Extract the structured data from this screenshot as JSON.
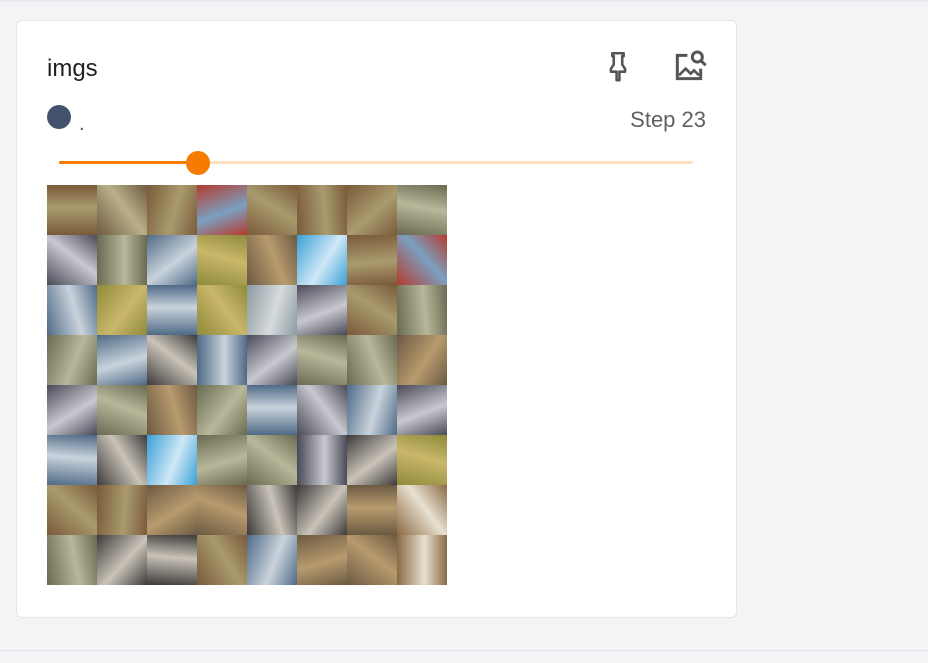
{
  "card": {
    "title": "imgs",
    "legend_label": ".",
    "step_text": "Step 23",
    "pin_icon": "pin-icon",
    "inspect_icon": "image-search-icon"
  },
  "colors": {
    "accent": "#f57c00",
    "legend_dot": "#45526c"
  },
  "slider": {
    "value_fraction": 0.22
  },
  "image_grid": {
    "rows": 8,
    "cols": 8,
    "tiles": [
      [
        "horse",
        "horse-rider",
        "horse",
        "fire-truck",
        "horse",
        "horse",
        "horse",
        "bird"
      ],
      [
        "car",
        "bird",
        "ship",
        "frog",
        "deer",
        "airplane",
        "horse",
        "fire-truck"
      ],
      [
        "ship",
        "frog",
        "ship",
        "frog",
        "truck",
        "car",
        "horse",
        "bird"
      ],
      [
        "bird",
        "ship",
        "cat",
        "ship",
        "car",
        "bird",
        "bird",
        "deer"
      ],
      [
        "car",
        "bird",
        "deer",
        "bird",
        "ship",
        "car",
        "ship",
        "car"
      ],
      [
        "ship",
        "cat",
        "airplane",
        "bird",
        "bird",
        "car",
        "cat",
        "frog"
      ],
      [
        "horse",
        "horse",
        "deer",
        "deer",
        "cat",
        "cat",
        "deer",
        "dog"
      ],
      [
        "bird",
        "cat",
        "cat",
        "horse",
        "ship",
        "deer",
        "deer",
        "dog"
      ]
    ]
  }
}
